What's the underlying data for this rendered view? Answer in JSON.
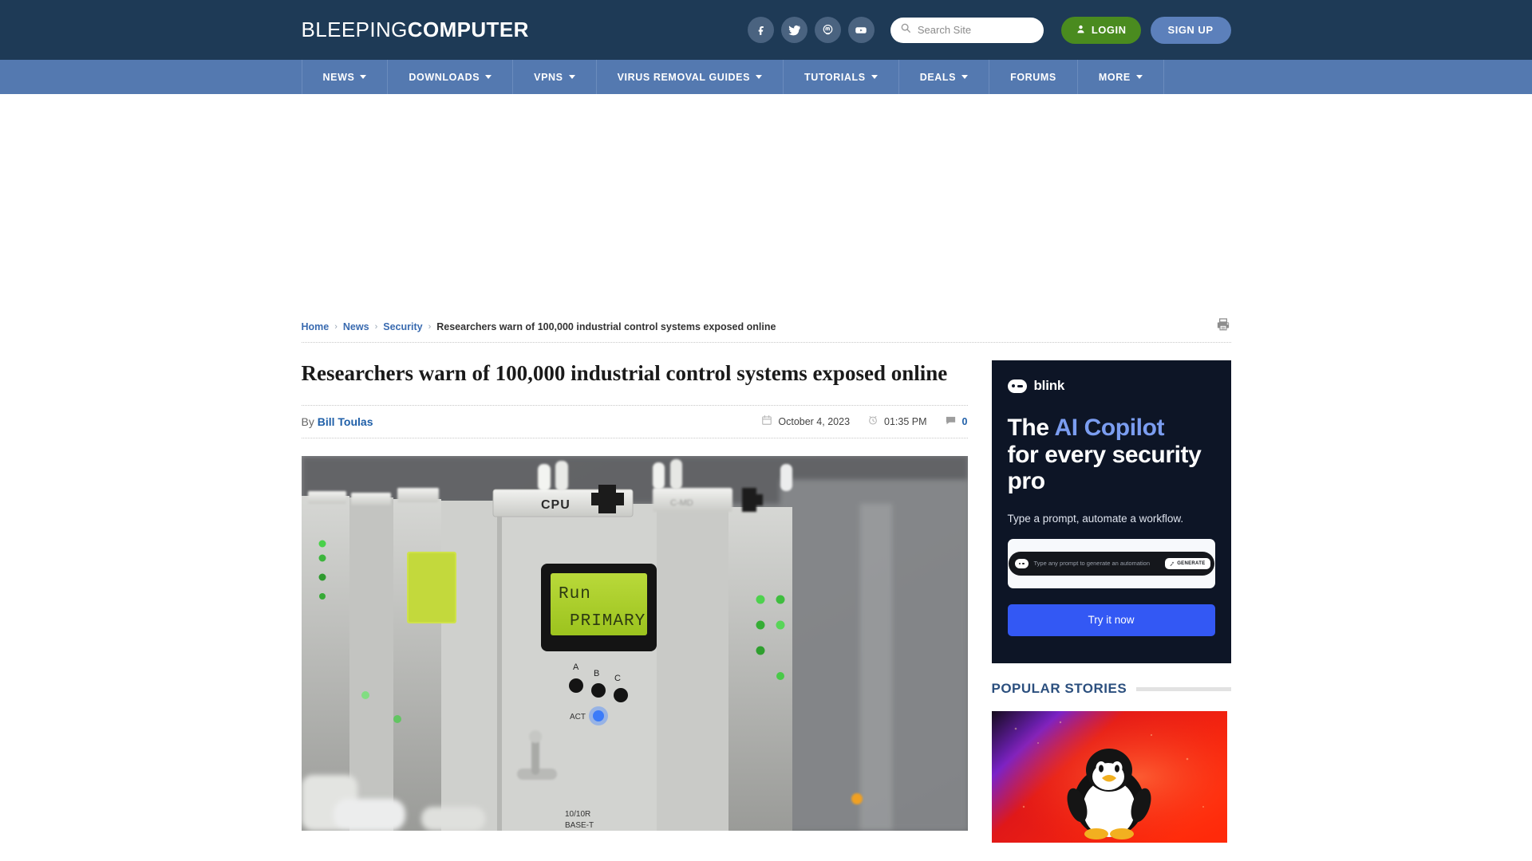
{
  "header": {
    "logo_thin": "BLEEPING",
    "logo_bold": "COMPUTER",
    "socials": [
      {
        "name": "facebook-icon",
        "label": "Facebook"
      },
      {
        "name": "twitter-icon",
        "label": "Twitter"
      },
      {
        "name": "mastodon-icon",
        "label": "Mastodon"
      },
      {
        "name": "youtube-icon",
        "label": "YouTube"
      }
    ],
    "search": {
      "placeholder": "Search Site",
      "value": "",
      "icon": "search-icon"
    },
    "login_label": "LOGIN",
    "login_icon": "user-icon",
    "signup_label": "SIGN UP",
    "colors": {
      "bar": "#1e3a56",
      "login": "#4a8b1f",
      "signup": "#5c80bb"
    }
  },
  "nav": {
    "items": [
      {
        "label": "NEWS",
        "has_dropdown": true
      },
      {
        "label": "DOWNLOADS",
        "has_dropdown": true
      },
      {
        "label": "VPNS",
        "has_dropdown": true
      },
      {
        "label": "VIRUS REMOVAL GUIDES",
        "has_dropdown": true
      },
      {
        "label": "TUTORIALS",
        "has_dropdown": true
      },
      {
        "label": "DEALS",
        "has_dropdown": true
      },
      {
        "label": "FORUMS",
        "has_dropdown": false
      },
      {
        "label": "MORE",
        "has_dropdown": true
      }
    ],
    "color": "#5479b0"
  },
  "breadcrumb": {
    "items": [
      {
        "label": "Home",
        "link": true
      },
      {
        "label": "News",
        "link": true
      },
      {
        "label": "Security",
        "link": true
      },
      {
        "label": "Researchers warn of 100,000 industrial control systems exposed online",
        "link": false
      }
    ],
    "separator": "›",
    "print_icon": "printer-icon"
  },
  "article": {
    "title": "Researchers warn of 100,000 industrial control systems exposed online",
    "by_prefix": "By",
    "author": "Bill Toulas",
    "date": "October 4, 2023",
    "date_icon": "calendar-icon",
    "time": "01:35 PM",
    "time_icon": "alarm-clock-icon",
    "comment_count": "0",
    "comment_icon": "comment-icon",
    "hero_alt": "Industrial control system PLC rack with CPU module and LCD display reading Run PRIMARY",
    "hero_labels": {
      "cpu": "CPU",
      "lcd_line1": "Run",
      "lcd_line2": "PRIMARY",
      "abc": [
        "A",
        "B",
        "C"
      ],
      "act": "ACT",
      "base": "10/10R BASE-T"
    }
  },
  "sidebar": {
    "ad": {
      "brand": "blink",
      "brand_icon": "blink-bot-icon",
      "headline_plain_1": "The ",
      "headline_accent": "AI Copilot",
      "headline_plain_2": "for every security pro",
      "subtext": "Type a prompt, automate a workflow.",
      "prompt_placeholder": "Type any prompt to generate an automation",
      "generate_label": "GENERATE",
      "generate_icon": "wand-icon",
      "cta_label": "Try it now",
      "colors": {
        "bg": "#0d1526",
        "accent": "#7b9df0",
        "cta": "#3358f4"
      }
    },
    "popular": {
      "title": "POPULAR STORIES",
      "thumb_alt": "Linux penguin Tux mascot on red and purple background"
    }
  }
}
